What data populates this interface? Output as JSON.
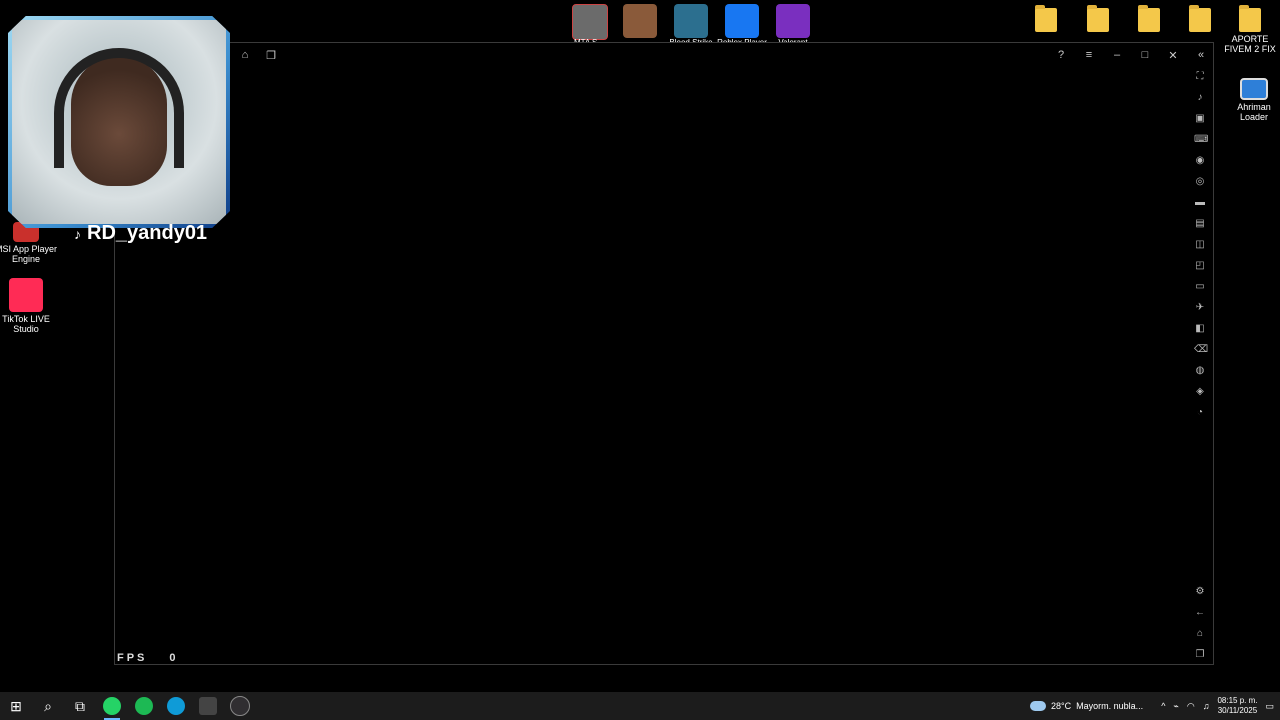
{
  "desktop_left": [
    {
      "name": "MSI App Player Engine",
      "color": "#c9302c"
    },
    {
      "name": "TikTok LIVE Studio",
      "color": "#ff2b55"
    }
  ],
  "desktop_right": [
    {
      "name": "APORTE FIVEM 2 FIX"
    },
    {
      "name": "Ahriman Loader"
    }
  ],
  "top_apps": [
    {
      "label": "MTA S...",
      "color": "#6b6b6b"
    },
    {
      "label": "",
      "color": "#8a5a3a"
    },
    {
      "label": "Blood Strike",
      "color": "#2c6f8f"
    },
    {
      "label": "Roblox Player",
      "color": "#1877f2"
    },
    {
      "label": "Valorant",
      "color": "#7a2fbf"
    }
  ],
  "webcam": {
    "username": "RD_yandy01"
  },
  "window": {
    "fps_label": "FPS",
    "fps_value": "0"
  },
  "taskbar": {
    "weather_temp": "28°C",
    "weather_text": "Mayorm. nubla...",
    "time": "08:15 p. m.",
    "date": "30/11/2025",
    "apps": [
      {
        "name": "whatsapp",
        "color": "#25d366",
        "active": true
      },
      {
        "name": "spotify",
        "color": "#1db954",
        "active": false
      },
      {
        "name": "edge",
        "color": "#0f9bd7",
        "active": false
      },
      {
        "name": "app-player",
        "color": "#444",
        "active": false
      },
      {
        "name": "obs",
        "color": "#302e31",
        "active": false
      }
    ]
  }
}
